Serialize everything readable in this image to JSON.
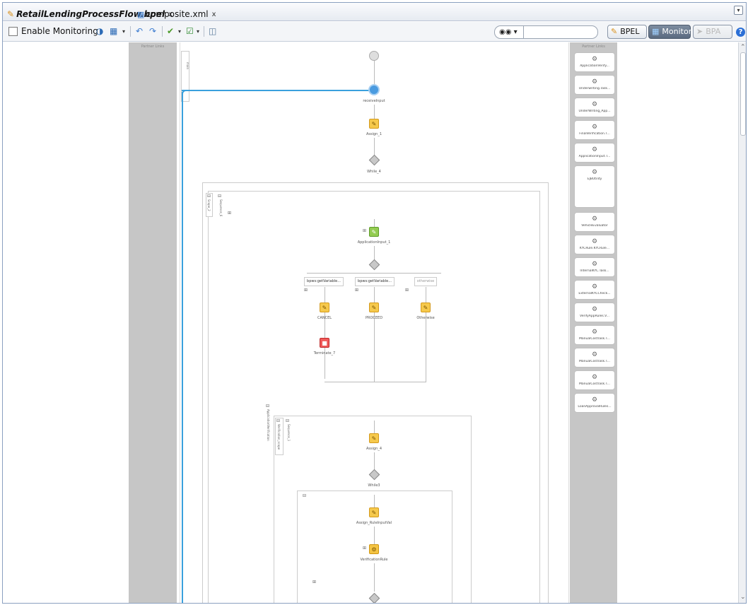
{
  "tabs": [
    {
      "label": "RetailLendingProcessFlow.bpel",
      "close": "x"
    },
    {
      "label": "composite.xml",
      "close": "x"
    }
  ],
  "toolbar": {
    "enable_monitoring": "Enable Monitoring",
    "search_menu": "▾",
    "bpel": "BPEL",
    "monitor": "Monitor",
    "bpa": "BPA",
    "help": "?"
  },
  "swimlanes": {
    "left_partner_links": "Partner Links",
    "right_partner_links": "Partner Links"
  },
  "partner_links": [
    "ApplicationVerify...",
    "Underwriting.Task...",
    "UnderWriting_App...",
    "FinalVerification.T...",
    "ApplicationInput.T...",
    "EJBUtility",
    "VehicleEvaluator",
    "KYCRule.KYCRule...",
    "InternalKYC.Task...",
    "ExternalKYCCheck...",
    "VerifyAppRules.V...",
    "ManualCostTask.T...",
    "ManualCostTask.T...",
    "ManualCostTask.T...",
    "LoanApprovalRules..."
  ],
  "process": {
    "main": "main",
    "receive": "receiveInput",
    "assign1": "Assign_1",
    "while4": "While_4",
    "scope": "Scope_2",
    "sequence6": "Sequence_6",
    "app_input": "ApplicationInput_1",
    "cond1": "bpws:getVariable...",
    "cond2": "bpws:getVariable...",
    "otherwise_box": "otherwise",
    "cancel": "CANCEL",
    "proceed": "PROCEED",
    "otherwise": "Otherwise",
    "terminate": "Terminate_7",
    "app_verification": "ApplicationVerification",
    "verification_scope": "Verification_scope",
    "sequence1": "Sequence_1",
    "assign4": "Assign_4",
    "while3": "While3",
    "assign_rule": "Assign_RuleInputVal",
    "verification_rule": "VerificationRule"
  },
  "colors": {
    "accent": "#3aa0dd",
    "monitor_active": "#5a6a80"
  }
}
